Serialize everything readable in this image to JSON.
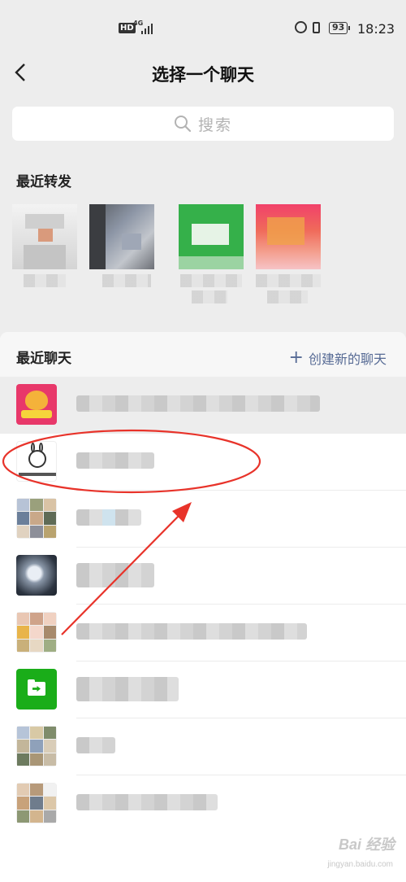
{
  "status_bar": {
    "hd": "HD",
    "network": "4G",
    "battery": "93",
    "time": "18:23"
  },
  "header": {
    "title": "选择一个聊天"
  },
  "search": {
    "placeholder": "搜索"
  },
  "recent_forward": {
    "title": "最近转发",
    "items": [
      {
        "avatar": "blurred-avatar-person"
      },
      {
        "avatar": "blurred-avatar-dark-photo"
      },
      {
        "avatar": "blurred-avatar-green"
      },
      {
        "avatar": "blurred-avatar-pink-red"
      }
    ]
  },
  "recent_chats": {
    "title": "最近聊天",
    "create_label": "创建新的聊天",
    "rows": [
      {
        "avatar": "cat-cartoon-avatar"
      },
      {
        "avatar": "rabbit-cartoon-avatar"
      },
      {
        "avatar": "group-photo-grid-avatar"
      },
      {
        "avatar": "dark-photo-avatar"
      },
      {
        "avatar": "group-photo-grid-avatar"
      },
      {
        "avatar": "file-transfer-icon"
      },
      {
        "avatar": "group-photo-grid-avatar"
      },
      {
        "avatar": "group-photo-grid-avatar"
      }
    ]
  },
  "watermark": {
    "text": "Bai 经验",
    "sub": "jingyan.baidu.com"
  },
  "colors": {
    "background": "#ededed",
    "link": "#576b95",
    "annotation": "#e8332a",
    "file_transfer_green": "#1aad19"
  }
}
